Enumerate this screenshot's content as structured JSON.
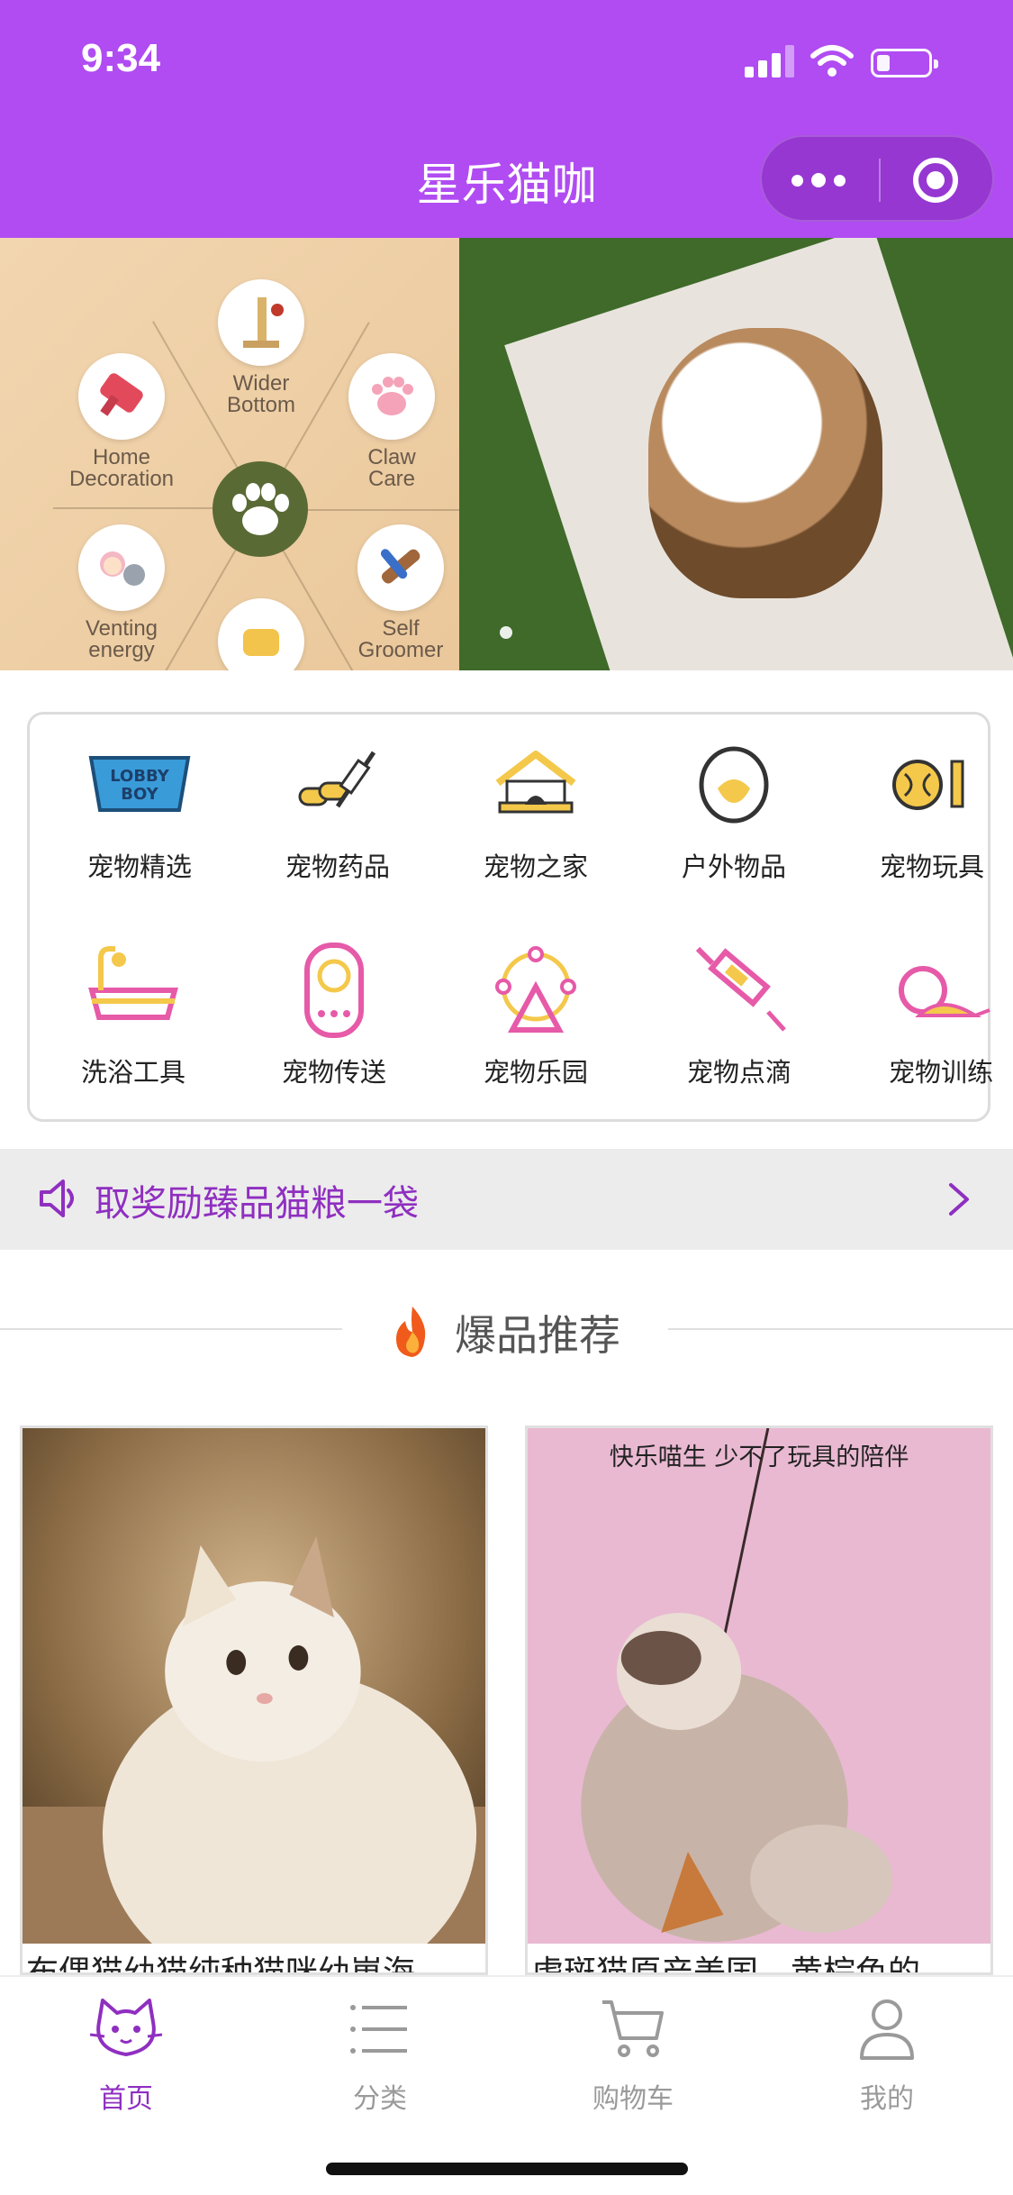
{
  "status_bar": {
    "time": "9:34"
  },
  "nav": {
    "title": "星乐猫咖"
  },
  "banner": {
    "features": [
      {
        "label": "Wider\nBottom",
        "icon": "scratch-post-icon"
      },
      {
        "label": "Claw\nCare",
        "icon": "paw-pad-icon"
      },
      {
        "label": "Home\nDecoration",
        "icon": "brush-icon"
      },
      {
        "label": "Venting\nenergy",
        "icon": "cat-girl-icon"
      },
      {
        "label": "Self\nGroomer",
        "icon": "groomer-brush-icon"
      }
    ]
  },
  "categories": [
    {
      "label": "宠物精选",
      "icon": "lobby-boy-icon"
    },
    {
      "label": "宠物药品",
      "icon": "syringe-pills-icon"
    },
    {
      "label": "宠物之家",
      "icon": "pet-house-icon"
    },
    {
      "label": "户外物品",
      "icon": "egg-icon"
    },
    {
      "label": "宠物玩具",
      "icon": "ball-bone-icon"
    },
    {
      "label": "洗浴工具",
      "icon": "bathtub-icon"
    },
    {
      "label": "宠物传送",
      "icon": "pet-carrier-icon"
    },
    {
      "label": "宠物乐园",
      "icon": "ferris-wheel-icon"
    },
    {
      "label": "宠物点滴",
      "icon": "syringe-icon"
    },
    {
      "label": "宠物训练",
      "icon": "mouse-toy-icon"
    }
  ],
  "notice": {
    "text": "取奖励臻品猫粮一袋"
  },
  "section": {
    "title": "爆品推荐"
  },
  "products": [
    {
      "name": "布偶猫幼猫纯种猫咪幼崽海",
      "caption": ""
    },
    {
      "name": "虎斑猫原产美国，黄棕色的",
      "caption": "快乐喵生 少不了玩具的陪伴"
    }
  ],
  "tabbar": [
    {
      "label": "首页",
      "icon": "cat-face-icon",
      "active": true
    },
    {
      "label": "分类",
      "icon": "list-icon",
      "active": false
    },
    {
      "label": "购物车",
      "icon": "cart-icon",
      "active": false
    },
    {
      "label": "我的",
      "icon": "user-icon",
      "active": false
    }
  ],
  "colors": {
    "brand": "#b04cf2",
    "accent_text": "#8f2fc0",
    "icon_yellow": "#f4c84a",
    "icon_pink": "#e65aa8"
  }
}
